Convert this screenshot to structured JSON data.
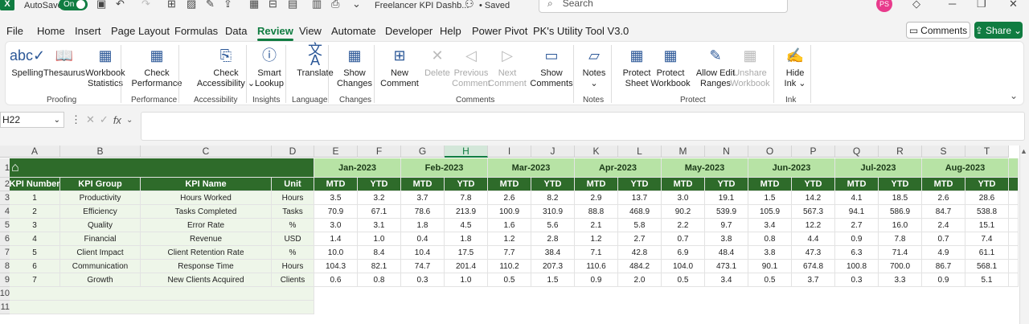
{
  "titlebar": {
    "autosave": "AutoSave",
    "toggle": "On",
    "doc_title": "Freelancer KPI Dashb...",
    "saved": "• Saved",
    "search_placeholder": "Search",
    "avatar": "PS"
  },
  "menu": [
    "File",
    "Home",
    "Insert",
    "Page Layout",
    "Formulas",
    "Data",
    "Review",
    "View",
    "Automate",
    "Developer",
    "Help",
    "Power Pivot",
    "PK's Utility Tool V3.0"
  ],
  "menu_active": "Review",
  "comments_btn": "Comments",
  "share_btn": "Share",
  "ribbon": {
    "buttons": [
      {
        "l1": "Spelling",
        "l2": "",
        "icon": "spelling-icon",
        "disabled": false
      },
      {
        "l1": "Thesaurus",
        "l2": "",
        "icon": "thesaurus-icon",
        "disabled": false
      },
      {
        "l1": "Workbook",
        "l2": "Statistics",
        "icon": "workbook-stats-icon",
        "disabled": false
      },
      {
        "l1": "Check",
        "l2": "Performance",
        "icon": "check-performance-icon",
        "disabled": false
      },
      {
        "l1": "Check",
        "l2": "Accessibility ⌄",
        "icon": "accessibility-icon",
        "disabled": false
      },
      {
        "l1": "Smart",
        "l2": "Lookup",
        "icon": "smart-lookup-icon",
        "disabled": false
      },
      {
        "l1": "Translate",
        "l2": "",
        "icon": "translate-icon",
        "disabled": false
      },
      {
        "l1": "Show",
        "l2": "Changes",
        "icon": "show-changes-icon",
        "disabled": false
      },
      {
        "l1": "New",
        "l2": "Comment",
        "icon": "new-comment-icon",
        "disabled": false
      },
      {
        "l1": "Delete",
        "l2": "",
        "icon": "delete-comment-icon",
        "disabled": true
      },
      {
        "l1": "Previous",
        "l2": "Comment",
        "icon": "previous-comment-icon",
        "disabled": true
      },
      {
        "l1": "Next",
        "l2": "Comment",
        "icon": "next-comment-icon",
        "disabled": true
      },
      {
        "l1": "Show",
        "l2": "Comments",
        "icon": "show-comments-icon",
        "disabled": false
      },
      {
        "l1": "Notes",
        "l2": "⌄",
        "icon": "notes-icon",
        "disabled": false
      },
      {
        "l1": "Protect",
        "l2": "Sheet",
        "icon": "protect-sheet-icon",
        "disabled": false
      },
      {
        "l1": "Protect",
        "l2": "Workbook",
        "icon": "protect-workbook-icon",
        "disabled": false
      },
      {
        "l1": "Allow Edit",
        "l2": "Ranges",
        "icon": "allow-edit-ranges-icon",
        "disabled": false
      },
      {
        "l1": "Unshare",
        "l2": "Workbook",
        "icon": "unshare-workbook-icon",
        "disabled": true
      },
      {
        "l1": "Hide",
        "l2": "Ink ⌄",
        "icon": "hide-ink-icon",
        "disabled": false
      }
    ],
    "groups": [
      "Proofing",
      "Performance",
      "Accessibility",
      "Insights",
      "Language",
      "Changes",
      "Comments",
      "Notes",
      "Protect",
      "Ink"
    ]
  },
  "namebox": "H22",
  "columns": [
    "A",
    "B",
    "C",
    "D",
    "E",
    "F",
    "G",
    "H",
    "I",
    "J",
    "K",
    "L",
    "M",
    "N",
    "O",
    "P",
    "Q",
    "R",
    "S",
    "T"
  ],
  "selected_column": "H",
  "rows": [
    "1",
    "2",
    "3",
    "4",
    "5",
    "6",
    "7",
    "8",
    "9",
    "10",
    "11"
  ],
  "sheet": {
    "months": [
      "Jan-2023",
      "Feb-2023",
      "Mar-2023",
      "Apr-2023",
      "May-2023",
      "Jun-2023",
      "Jul-2023",
      "Aug-2023"
    ],
    "headers": [
      "KPI Number",
      "KPI Group",
      "KPI Name",
      "Unit"
    ],
    "mtd": "MTD",
    "ytd": "YTD",
    "data": [
      [
        "1",
        "Productivity",
        "Hours Worked",
        "Hours",
        "3.5",
        "3.2",
        "3.7",
        "7.8",
        "2.6",
        "8.2",
        "2.9",
        "13.7",
        "3.0",
        "19.1",
        "1.5",
        "14.2",
        "4.1",
        "18.5",
        "2.6",
        "28.6"
      ],
      [
        "2",
        "Efficiency",
        "Tasks Completed",
        "Tasks",
        "70.9",
        "67.1",
        "78.6",
        "213.9",
        "100.9",
        "310.9",
        "88.8",
        "468.9",
        "90.2",
        "539.9",
        "105.9",
        "567.3",
        "94.1",
        "586.9",
        "84.7",
        "538.8"
      ],
      [
        "3",
        "Quality",
        "Error Rate",
        "%",
        "3.0",
        "3.1",
        "1.8",
        "4.5",
        "1.6",
        "5.6",
        "2.1",
        "5.8",
        "2.2",
        "9.7",
        "3.4",
        "12.2",
        "2.7",
        "16.0",
        "2.4",
        "15.1"
      ],
      [
        "4",
        "Financial",
        "Revenue",
        "USD",
        "1.4",
        "1.0",
        "0.4",
        "1.8",
        "1.2",
        "2.8",
        "1.2",
        "2.7",
        "0.7",
        "3.8",
        "0.8",
        "4.4",
        "0.9",
        "7.8",
        "0.7",
        "7.4"
      ],
      [
        "5",
        "Client Impact",
        "Client Retention Rate",
        "%",
        "10.0",
        "8.4",
        "10.4",
        "17.5",
        "7.7",
        "38.4",
        "7.1",
        "42.8",
        "6.9",
        "48.4",
        "3.8",
        "47.3",
        "6.3",
        "71.4",
        "4.9",
        "61.1"
      ],
      [
        "6",
        "Communication",
        "Response Time",
        "Hours",
        "104.3",
        "82.1",
        "74.7",
        "201.4",
        "110.2",
        "207.3",
        "110.6",
        "484.2",
        "104.0",
        "473.1",
        "90.1",
        "674.8",
        "100.8",
        "700.0",
        "86.7",
        "568.1"
      ],
      [
        "7",
        "Growth",
        "New Clients Acquired",
        "Clients",
        "0.6",
        "0.8",
        "0.3",
        "1.0",
        "0.5",
        "1.5",
        "0.9",
        "2.0",
        "0.5",
        "3.4",
        "0.5",
        "3.7",
        "0.3",
        "3.3",
        "0.9",
        "5.1"
      ]
    ]
  }
}
